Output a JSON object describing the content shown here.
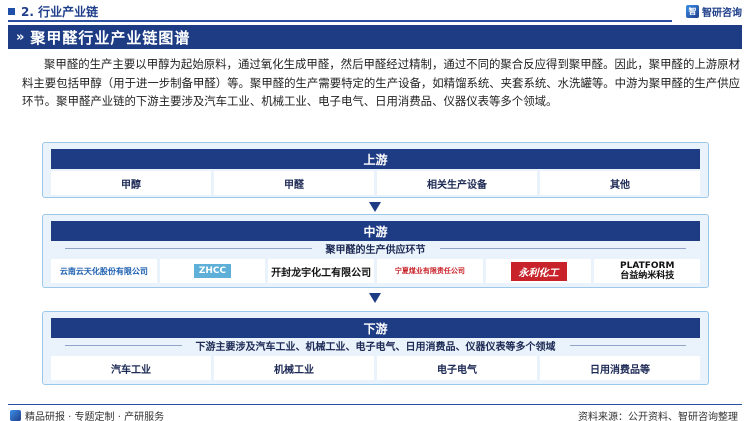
{
  "header": {
    "section": "2. 行业产业链",
    "logo_text": "智研咨询",
    "title": "聚甲醛行业产业链图谱"
  },
  "intro": "聚甲醛的生产主要以甲醇为起始原料，通过氧化生成甲醛，然后甲醛经过精制，通过不同的聚合反应得到聚甲醛。因此，聚甲醛的上游原材料主要包括甲醇（用于进一步制备甲醛）等。聚甲醛的生产需要特定的生产设备，如精馏系统、夹套系统、水洗罐等。中游为聚甲醛的生产供应环节。聚甲醛产业链的下游主要涉及汽车工业、机械工业、电子电气、日用消费品、仪器仪表等多个领域。",
  "upstream": {
    "title": "上游",
    "items": [
      "甲醇",
      "甲醛",
      "相关生产设备",
      "其他"
    ]
  },
  "midstream": {
    "title": "中游",
    "subtitle": "聚甲醛的生产供应环节",
    "companies": [
      "云南云天化股份有限公司",
      "ZHCC",
      "开封龙宇化工有限公司",
      "宁夏煤业有限责任公司",
      "永利化工",
      "PLATFORM",
      "台益纳米科技"
    ]
  },
  "downstream": {
    "title": "下游",
    "subtitle": "下游主要涉及汽车工业、机械工业、电子电气、日用消费品、仪器仪表等多个领域",
    "items": [
      "汽车工业",
      "机械工业",
      "电子电气",
      "日用消费品等"
    ]
  },
  "footer": {
    "left": "精品研报 · 专题定制 · 产研服务",
    "source": "资料来源：公开资料、智研咨询整理"
  },
  "colors": {
    "navy": "#1d3c84",
    "panel_bg": "#eaf3fb",
    "panel_border": "#9cc8ea"
  }
}
